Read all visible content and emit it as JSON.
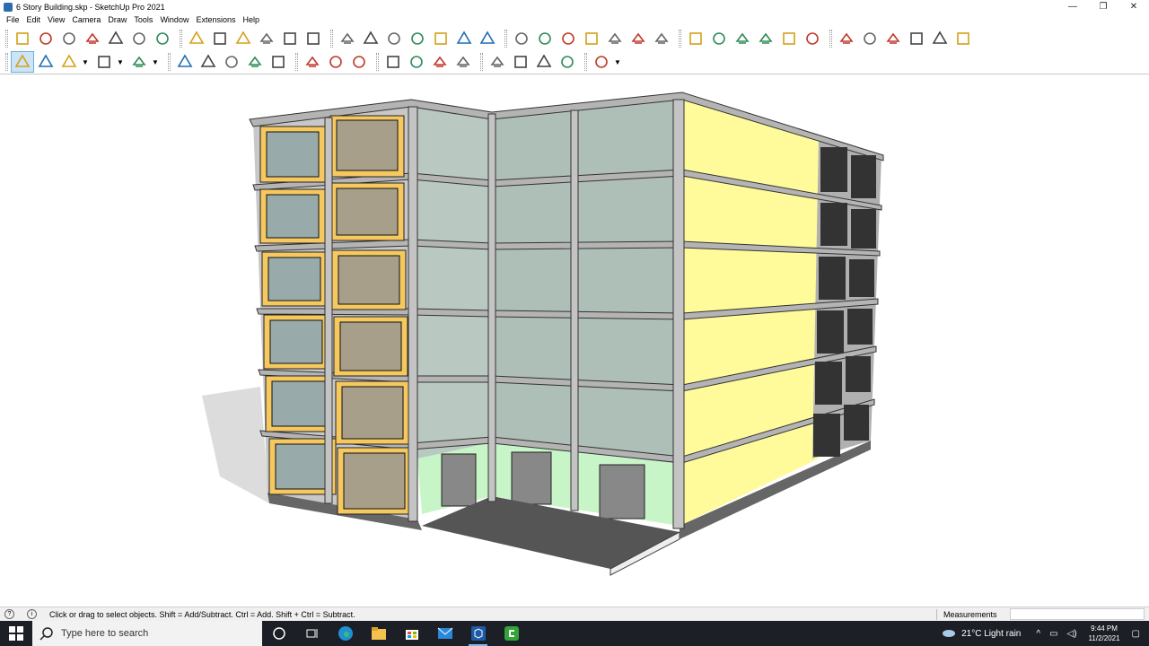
{
  "window": {
    "title": "6 Story Building.skp - SketchUp Pro 2021",
    "minimize_glyph": "—",
    "maximize_glyph": "❐",
    "close_glyph": "✕"
  },
  "menu": [
    "File",
    "Edit",
    "View",
    "Camera",
    "Draw",
    "Tools",
    "Window",
    "Extensions",
    "Help"
  ],
  "toolbar1_icons": [
    "sandbox-from-contours-icon",
    "sandbox-from-scratch-icon",
    "smoove-icon",
    "stamp-icon",
    "drape-icon",
    "add-detail-icon",
    "flip-edge-icon",
    "section-plane-icon",
    "display-section-planes-icon",
    "outliner-icon",
    "scenes-icon",
    "styles-icon",
    "layers-icon",
    "lock-icon",
    "solid-outer-shell-icon",
    "solid-intersect-icon",
    "solid-union-icon",
    "solid-subtract-icon",
    "solid-trim-icon",
    "solid-split-icon",
    "iso-view-icon",
    "top-view-icon",
    "front-view-icon",
    "right-view-icon",
    "back-view-icon",
    "left-view-icon",
    "bottom-view-icon",
    "shaded-textures-icon",
    "axes-icon",
    "guides-icon",
    "shadows-icon",
    "fog-icon",
    "edge-style-icon",
    "warehouse-icon",
    "extension-warehouse-icon",
    "share-model-icon",
    "layout-icon",
    "photo-texture-icon",
    "match-photo-icon"
  ],
  "toolbar2_icons": [
    "select-icon",
    "eraser-icon",
    "line-icon",
    "arc-icon",
    "rectangle-icon",
    "push-pull-icon",
    "follow-me-icon",
    "move-icon",
    "rotate-icon",
    "scale-icon",
    "tape-measure-icon",
    "text-icon",
    "paint-bucket-icon",
    "orbit-icon",
    "pan-icon",
    "zoom-icon",
    "zoom-extents-icon",
    "3d-warehouse-icon",
    "components-icon",
    "materials-icon",
    "layers-panel-icon",
    "account-icon"
  ],
  "status": {
    "message": "Click or drag to select objects. Shift = Add/Subtract. Ctrl = Add. Shift + Ctrl = Subtract.",
    "measurements_label": "Measurements",
    "measurements_value": ""
  },
  "taskbar": {
    "search_placeholder": "Type here to search",
    "weather": "21°C  Light rain",
    "time": "9:44 PM",
    "date": "11/2/2021"
  },
  "colors": {
    "facade_yellow": "#fffa9a",
    "frame_orange": "#f5c860",
    "glass": "#a8b8b0",
    "ground_green": "#c8f5c8",
    "slab_grey": "#b4b4b4"
  }
}
